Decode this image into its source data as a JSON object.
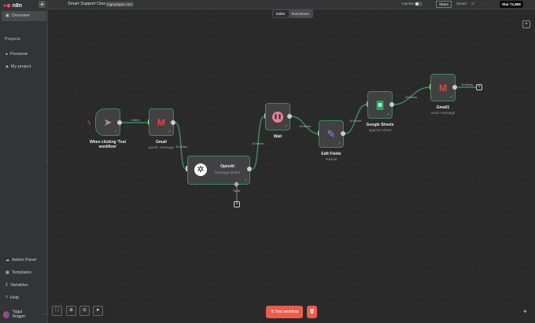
{
  "app": {
    "logo": "n8n",
    "new_label": "+"
  },
  "sidebar": {
    "overview": "Overview",
    "projects_label": "Projects",
    "personal": "Personal",
    "my_project": "My project",
    "admin_panel": "Admin Panel",
    "templates": "Templates",
    "variables": "Variables",
    "help": "Help",
    "user": "Yugui Dragon"
  },
  "header": {
    "title": "Smart Support Classifier",
    "tag": "tugautagos.com",
    "status": "Inactive",
    "share": "Share",
    "saved": "Saved",
    "more": "···",
    "star": "Star",
    "star_count": "71,855"
  },
  "tabs": {
    "editor": "Editor",
    "executions": "Executions"
  },
  "nodes": {
    "trigger": {
      "label": "When clicking 'Test workflow'"
    },
    "gmail": {
      "label": "Gmail",
      "sub": "getAll: message"
    },
    "openai": {
      "label": "OpenAI",
      "sub": "Message Model",
      "tools": "Tools"
    },
    "wait": {
      "label": "Wait"
    },
    "edit": {
      "label": "Edit Fields",
      "sub": "manual"
    },
    "sheets": {
      "label": "Google Sheets",
      "sub": "append: sheet"
    },
    "gmail1": {
      "label": "Gmail1",
      "sub": "send: message"
    }
  },
  "edges": [
    "1 item",
    "10 items",
    "10 items",
    "10 items",
    "10 items",
    "10 items",
    "10 items"
  ],
  "footer": {
    "test_workflow": "Test workflow"
  },
  "colors": {
    "accent": "#ea5c4c",
    "success": "#3c8b56"
  }
}
